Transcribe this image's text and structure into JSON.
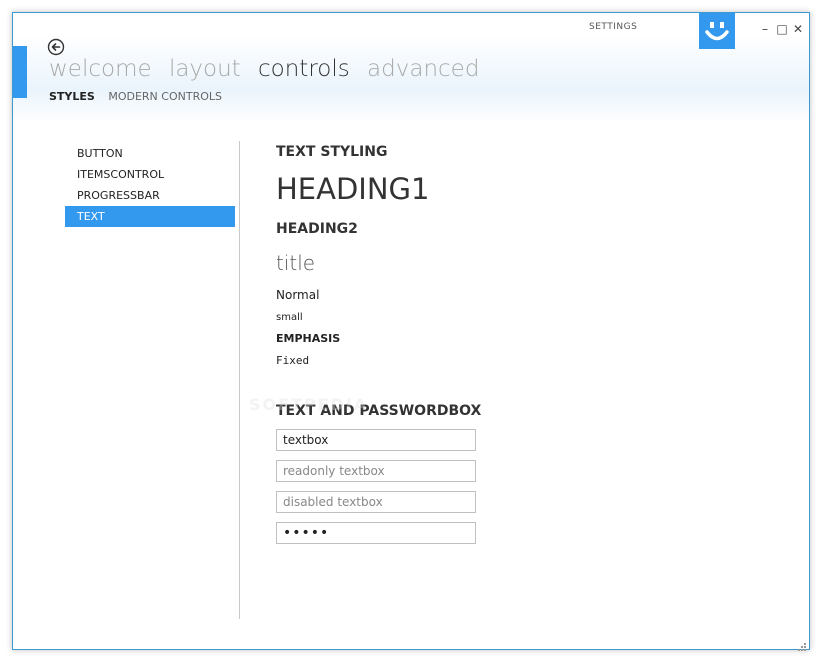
{
  "window": {
    "title": "SETTINGS",
    "controls": {
      "minimize": "–",
      "maximize": "□",
      "close": "✕"
    },
    "accent_color": "#3399ee"
  },
  "nav": {
    "menu": [
      {
        "label": "welcome",
        "active": false
      },
      {
        "label": "layout",
        "active": false
      },
      {
        "label": "controls",
        "active": true
      },
      {
        "label": "advanced",
        "active": false
      }
    ],
    "submenu": [
      {
        "label": "STYLES",
        "active": true
      },
      {
        "label": "MODERN CONTROLS",
        "active": false
      }
    ]
  },
  "sidebar": {
    "items": [
      {
        "label": "BUTTON",
        "selected": false
      },
      {
        "label": "ITEMSCONTROL",
        "selected": false
      },
      {
        "label": "PROGRESSBAR",
        "selected": false
      },
      {
        "label": "TEXT",
        "selected": true
      }
    ]
  },
  "content": {
    "text_styling_header": "TEXT STYLING",
    "heading1": "HEADING1",
    "heading2": "HEADING2",
    "title": "title",
    "normal": "Normal",
    "small": "small",
    "emphasis": "EMPHASIS",
    "fixed": "Fixed",
    "textbox_header": "TEXT AND PASSWORDBOX",
    "textbox_value": "textbox",
    "readonly_value": "readonly textbox",
    "disabled_value": "disabled textbox",
    "password_value": "•••••"
  },
  "watermark": "SOFTPEDIA"
}
